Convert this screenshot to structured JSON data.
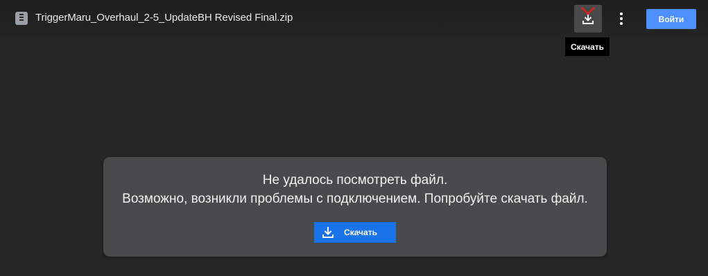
{
  "header": {
    "file_name": "TriggerMaru_Overhaul_2-5_UpdateBH Revised Final.zip",
    "file_icon": "zip-file-icon",
    "download_icon": "download-icon",
    "more_icon": "more-vertical-icon",
    "download_tooltip": "Скачать",
    "signin_label": "Войти"
  },
  "error_card": {
    "line1": "Не удалось посмотреть файл.",
    "line2": "Возможно, возникли проблемы с подключением. Попробуйте скачать файл.",
    "download_label": "Скачать",
    "download_icon": "download-icon"
  },
  "colors": {
    "background": "#262626",
    "card_background": "#4a494c",
    "signin_button": "#4d90fe",
    "download_button": "#1a73e8",
    "tooltip_background": "#000000",
    "annotation_mark": "#e51c23"
  }
}
